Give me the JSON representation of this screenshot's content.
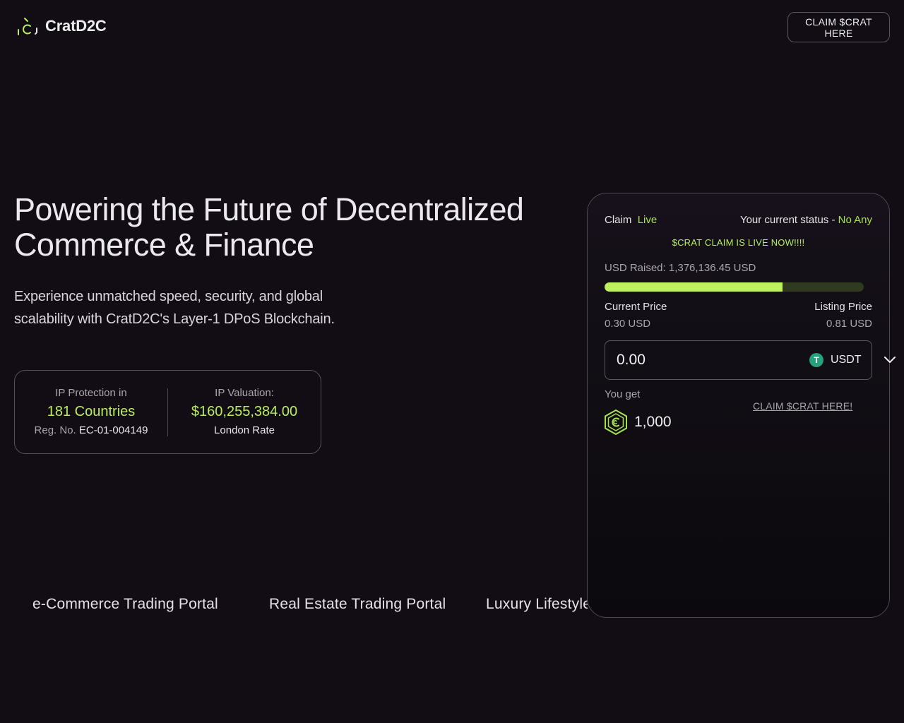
{
  "header": {
    "brand": "CratD2C",
    "claim_button": "CLAIM $CRAT HERE"
  },
  "hero": {
    "title": "Powering the Future of Decentralized Commerce & Finance",
    "subtitle": "Experience unmatched speed, security, and global scalability with CratD2C's Layer-1 DPoS Blockchain."
  },
  "stats": {
    "ip_protection": {
      "label": "IP Protection in",
      "value": "181 Countries",
      "reg_prefix": "Reg. No.",
      "reg_number": "EC-01-004149"
    },
    "ip_valuation": {
      "label": "IP Valuation:",
      "value": "$160,255,384.00",
      "meta": "London Rate"
    }
  },
  "portals": [
    "e-Commerce Trading Portal",
    "Real Estate Trading Portal",
    "Luxury Lifestyle"
  ],
  "card": {
    "claim_label": "Claim",
    "claim_state": "Live",
    "status_label": "Your current status - ",
    "status_value": "No Any",
    "live_banner": "$CRAT CLAIM IS LIVE NOW!!!!",
    "raised_text": "USD Raised: 1,376,136.45 USD",
    "progress_fraction": 0.688,
    "current_price_label": "Current Price",
    "current_price_value": "0.30 USD",
    "listing_price_label": "Listing Price",
    "listing_price_value": "0.81 USD",
    "amount_value": "0.00",
    "currency": "USDT",
    "you_get_label": "You get",
    "token_amount": "1,000",
    "claim_link": "CLAIM $CRAT HERE!"
  },
  "colors": {
    "background": "#120d15",
    "accent": "#b9ef5a",
    "usdt": "#26a17b"
  },
  "icons": {
    "logo": "cratd2c-logo-icon",
    "usdt": "usdt-icon",
    "dropdown": "chevron-down-icon",
    "token": "crat-token-icon"
  }
}
